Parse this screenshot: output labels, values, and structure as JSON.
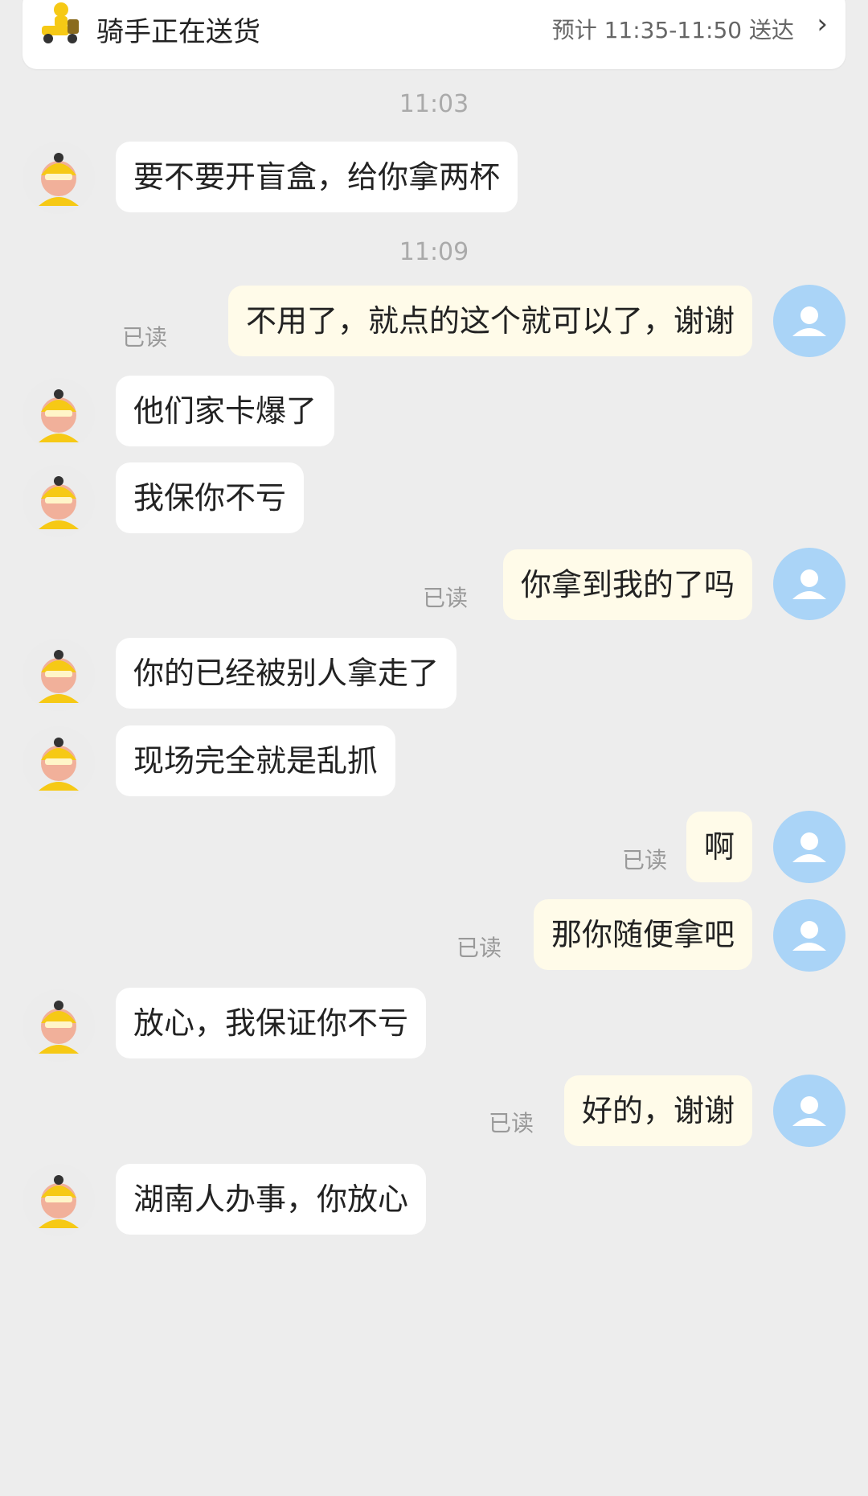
{
  "header": {
    "title": "骑手正在送货",
    "eta": "预计 11:35-11:50 送达",
    "arrow": "›"
  },
  "colors": {
    "background": "#ededed",
    "incoming_bubble": "#ffffff",
    "outgoing_bubble": "#fffbe9",
    "rider_helmet": "#f6c915",
    "user_avatar": "#aad4f7"
  },
  "icons": {
    "header": "scooter-rider-icon",
    "rider_avatar": "rider-avatar-icon",
    "user_avatar": "user-avatar-icon"
  },
  "timestamps": [
    "11:03",
    "11:09"
  ],
  "read_label": "已读",
  "messages": [
    {
      "side": "in",
      "text": "要不要开盲盒，给你拿两杯"
    },
    {
      "side": "out",
      "text": "不用了，就点的这个就可以了，谢谢",
      "read": "已读"
    },
    {
      "side": "in",
      "text": "他们家卡爆了"
    },
    {
      "side": "in",
      "text": "我保你不亏"
    },
    {
      "side": "out",
      "text": "你拿到我的了吗",
      "read": "已读"
    },
    {
      "side": "in",
      "text": "你的已经被别人拿走了"
    },
    {
      "side": "in",
      "text": "现场完全就是乱抓"
    },
    {
      "side": "out",
      "text": "啊",
      "read": "已读"
    },
    {
      "side": "out",
      "text": "那你随便拿吧",
      "read": "已读"
    },
    {
      "side": "in",
      "text": "放心，我保证你不亏"
    },
    {
      "side": "out",
      "text": "好的，谢谢",
      "read": "已读"
    },
    {
      "side": "in",
      "text": "湖南人办事，你放心"
    }
  ]
}
